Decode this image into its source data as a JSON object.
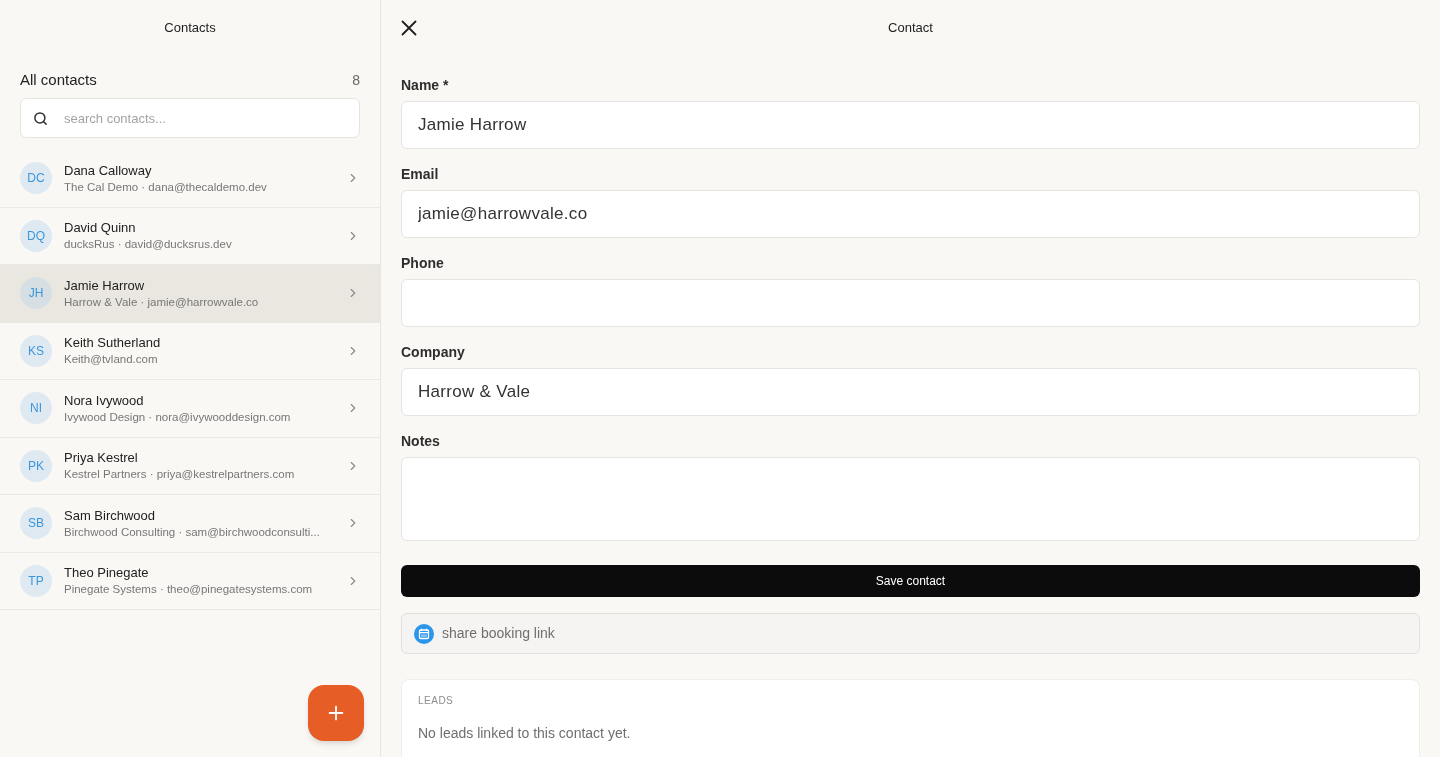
{
  "sidebar": {
    "title": "Contacts",
    "list_title": "All contacts",
    "count": "8",
    "search": {
      "placeholder": "search contacts..."
    },
    "contacts": [
      {
        "initials": "DC",
        "name": "Dana Calloway",
        "subtitle": "The Cal Demo · dana@thecaldemo.dev",
        "selected": false
      },
      {
        "initials": "DQ",
        "name": "David Quinn",
        "subtitle": "ducksRus · david@ducksrus.dev",
        "selected": false
      },
      {
        "initials": "JH",
        "name": "Jamie Harrow",
        "subtitle": "Harrow & Vale · jamie@harrowvale.co",
        "selected": true
      },
      {
        "initials": "KS",
        "name": "Keith Sutherland",
        "subtitle": "Keith@tvland.com",
        "selected": false
      },
      {
        "initials": "NI",
        "name": "Nora Ivywood",
        "subtitle": "Ivywood Design · nora@ivywooddesign.com",
        "selected": false
      },
      {
        "initials": "PK",
        "name": "Priya Kestrel",
        "subtitle": "Kestrel Partners · priya@kestrelpartners.com",
        "selected": false
      },
      {
        "initials": "SB",
        "name": "Sam Birchwood",
        "subtitle": "Birchwood Consulting · sam@birchwoodconsulti...",
        "selected": false
      },
      {
        "initials": "TP",
        "name": "Theo Pinegate",
        "subtitle": "Pinegate Systems · theo@pinegatesystems.com",
        "selected": false
      }
    ]
  },
  "detail": {
    "title": "Contact",
    "fields": [
      {
        "label": "Name *",
        "kind": "input",
        "value": "Jamie Harrow"
      },
      {
        "label": "Email",
        "kind": "input",
        "value": "jamie@harrowvale.co"
      },
      {
        "label": "Phone",
        "kind": "input"
      },
      {
        "label": "Company",
        "kind": "input",
        "value": "Harrow & Vale"
      },
      {
        "label": "Notes",
        "kind": "textarea"
      }
    ],
    "save_button": "Save contact",
    "booking_link": "share booking link",
    "leads": {
      "heading": "LEADS",
      "empty_text": "No leads linked to this contact yet."
    }
  }
}
